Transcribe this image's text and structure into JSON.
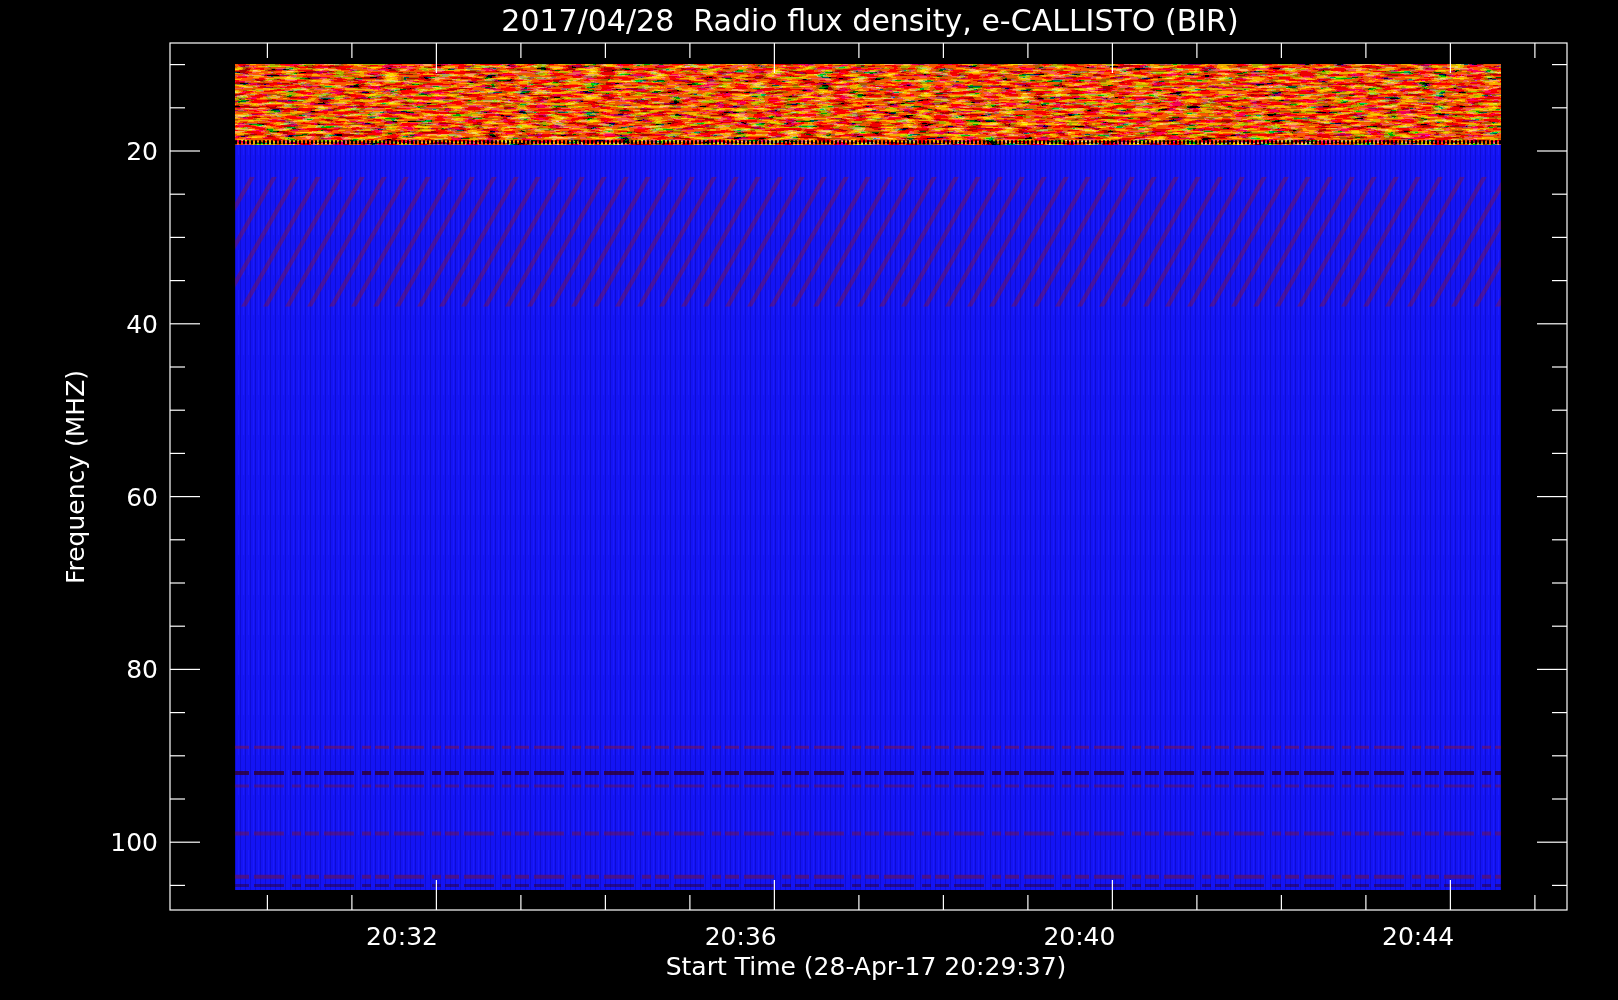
{
  "plot": {
    "title": "2017/04/28  Radio flux density, e-CALLISTO (BIR)",
    "ylabel": "Frequency (MHZ)",
    "xlabel": "Start Time (28-Apr-17 20:29:37)",
    "yticks": [
      "20",
      "40",
      "60",
      "80",
      "100"
    ],
    "xticks": [
      "20:32",
      "20:36",
      "20:40",
      "20:44"
    ]
  }
}
